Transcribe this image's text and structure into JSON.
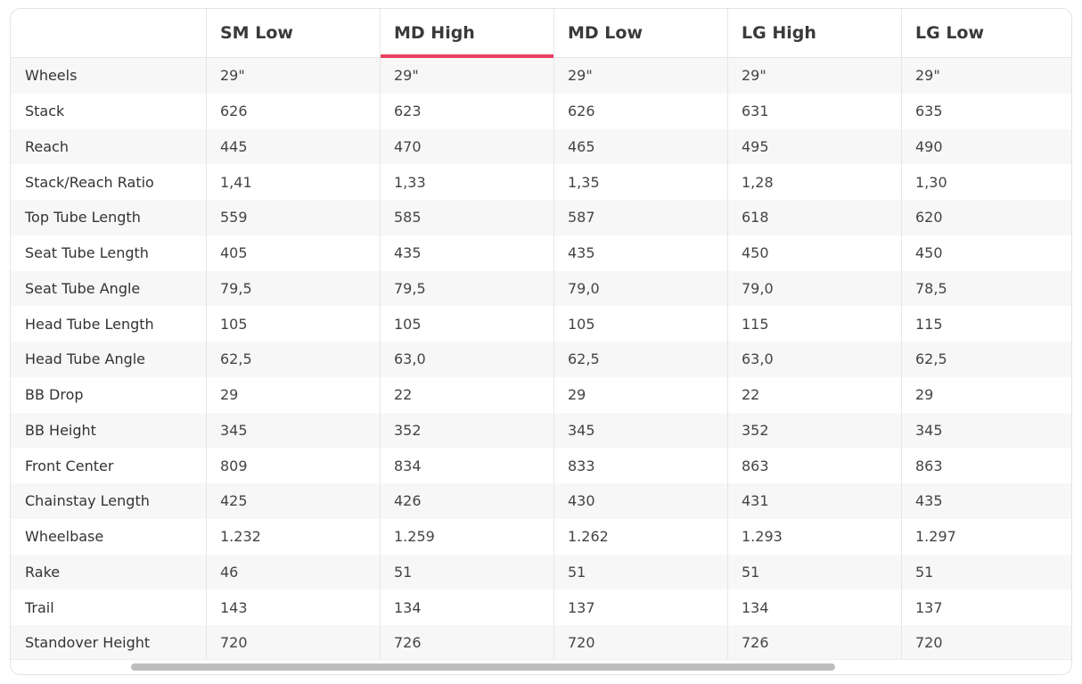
{
  "table": {
    "headers": [
      "",
      "SM Low",
      "MD High",
      "MD Low",
      "LG High",
      "LG Low"
    ],
    "active_header_index": 2,
    "accent_color": "#e9405f",
    "rows": [
      {
        "label": "Wheels",
        "values": [
          "29\"",
          "29\"",
          "29\"",
          "29\"",
          "29\""
        ]
      },
      {
        "label": "Stack",
        "values": [
          "626",
          "623",
          "626",
          "631",
          "635"
        ]
      },
      {
        "label": "Reach",
        "values": [
          "445",
          "470",
          "465",
          "495",
          "490"
        ]
      },
      {
        "label": "Stack/Reach Ratio",
        "values": [
          "1,41",
          "1,33",
          "1,35",
          "1,28",
          "1,30"
        ]
      },
      {
        "label": "Top Tube Length",
        "values": [
          "559",
          "585",
          "587",
          "618",
          "620"
        ]
      },
      {
        "label": "Seat Tube Length",
        "values": [
          "405",
          "435",
          "435",
          "450",
          "450"
        ]
      },
      {
        "label": "Seat Tube Angle",
        "values": [
          "79,5",
          "79,5",
          "79,0",
          "79,0",
          "78,5"
        ]
      },
      {
        "label": "Head Tube Length",
        "values": [
          "105",
          "105",
          "105",
          "115",
          "115"
        ]
      },
      {
        "label": "Head Tube Angle",
        "values": [
          "62,5",
          "63,0",
          "62,5",
          "63,0",
          "62,5"
        ]
      },
      {
        "label": "BB Drop",
        "values": [
          "29",
          "22",
          "29",
          "22",
          "29"
        ]
      },
      {
        "label": "BB Height",
        "values": [
          "345",
          "352",
          "345",
          "352",
          "345"
        ]
      },
      {
        "label": "Front Center",
        "values": [
          "809",
          "834",
          "833",
          "863",
          "863"
        ]
      },
      {
        "label": "Chainstay Length",
        "values": [
          "425",
          "426",
          "430",
          "431",
          "435"
        ]
      },
      {
        "label": "Wheelbase",
        "values": [
          "1.232",
          "1.259",
          "1.262",
          "1.293",
          "1.297"
        ]
      },
      {
        "label": "Rake",
        "values": [
          "46",
          "51",
          "51",
          "51",
          "51"
        ]
      },
      {
        "label": "Trail",
        "values": [
          "143",
          "134",
          "137",
          "134",
          "137"
        ]
      },
      {
        "label": "Standover Height",
        "values": [
          "720",
          "726",
          "720",
          "726",
          "720"
        ]
      }
    ]
  }
}
